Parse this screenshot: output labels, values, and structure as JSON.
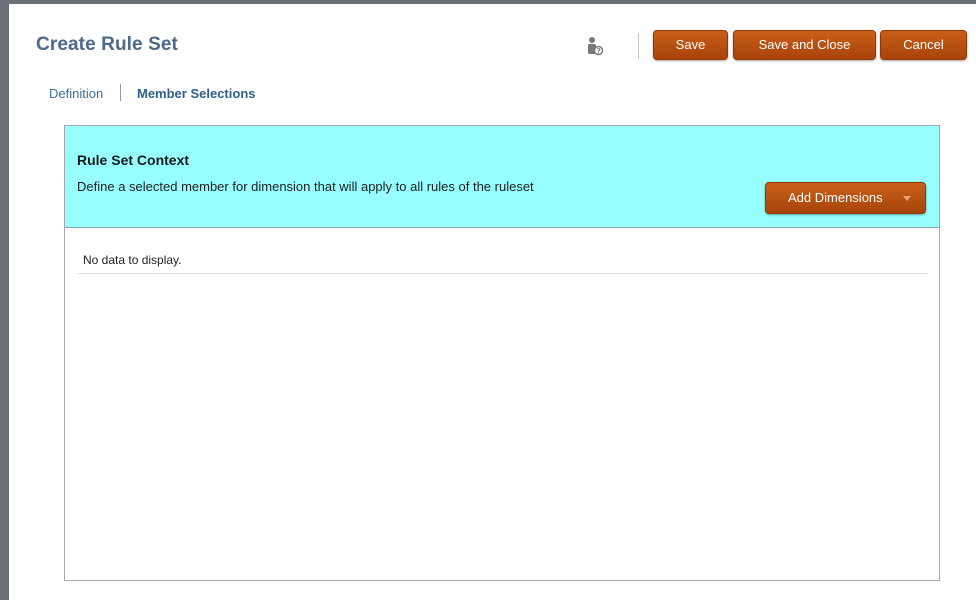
{
  "header": {
    "title": "Create Rule Set",
    "help_icon": "user-help-icon"
  },
  "toolbar": {
    "save_label": "Save",
    "save_close_label": "Save and Close",
    "cancel_label": "Cancel"
  },
  "nav": {
    "items": [
      {
        "label": "Definition",
        "active": false
      },
      {
        "label": "Member Selections",
        "active": true
      }
    ]
  },
  "panel": {
    "title": "Rule Set Context",
    "description": "Define a selected member for dimension that will apply to all rules of the ruleset",
    "add_dimensions_label": "Add Dimensions",
    "dropdown_icon": "chevron-down-icon",
    "empty_message": "No data to display."
  },
  "colors": {
    "title": "#4c6a8c",
    "button": "#b84f10",
    "panel_header": "#96fefe",
    "nav_link": "#3b6f9e"
  }
}
